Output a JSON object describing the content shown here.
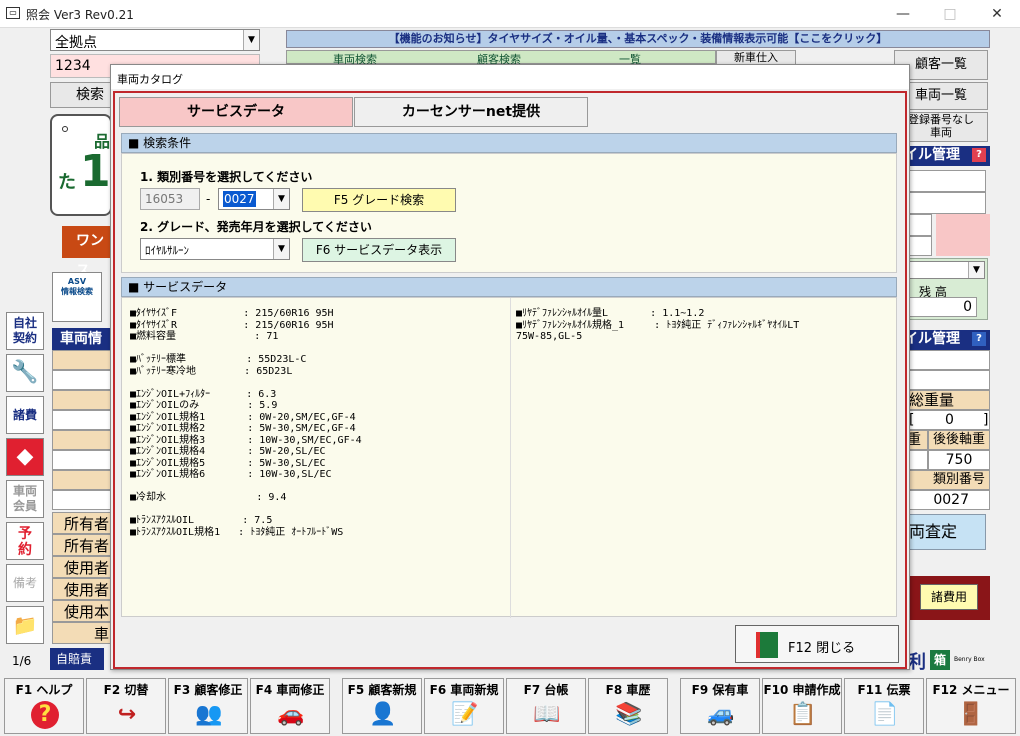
{
  "window": {
    "title": "照会 Ver3 Rev0.21",
    "min": "—",
    "max": "□",
    "close": "✕"
  },
  "bg": {
    "store_select": "全拠点",
    "code_field": "1234",
    "search_btn": "検索",
    "notice_bar": "【機能のお知らせ】タイヤサイズ・オイル量、・基本スペック・装備情報表示可能【ここをクリック】",
    "tabs_top": [
      "車両検索",
      "顧客検索",
      "一覧"
    ],
    "new_btn": "新車仕入",
    "right_buttons": [
      "顧客一覧",
      "車両一覧",
      "登録番号なし\n車両"
    ],
    "oil_mgmt": "イル管理",
    "plate_hira": "た",
    "plate_num": "1",
    "plate_region": "品",
    "onestop": "ワンス",
    "asv_label": "ASV\n情報検索",
    "vehicle_info": "車両情",
    "zan_ko": "残 高",
    "zan_val": "0",
    "oil_mgmt2": "イル管理",
    "total_weight": "総重量",
    "tw_open": "[",
    "tw_val": "0",
    "tw_close": "]",
    "weight": "重",
    "rear_axle": "後後軸重",
    "rear_val": "750",
    "type_no_label": "類別番号",
    "type_no_val": "0027",
    "satei": "両査定",
    "shohiyo": "諸費用",
    "owner_rows": [
      "所有者",
      "所有者",
      "使用者",
      "使用者",
      "使用本",
      "車"
    ],
    "page": "1/6",
    "jibaiseki": "自賠責",
    "logo_text": "利",
    "logo_box": "箱",
    "logo_sub": "Benry Box",
    "left_icons": [
      "自社\n契約",
      "🔧",
      "諸費",
      "◆",
      "車両\n会員",
      "予\n約",
      "備考",
      "📁"
    ]
  },
  "modal": {
    "title": "車両カタログ",
    "tab_service": "サービスデータ",
    "tab_carsensor": "カーセンサーnet提供",
    "search_header": "■ 検索条件",
    "step1": "1. 類別番号を選択してください",
    "type1": "16053",
    "dash": "-",
    "type2": "0027",
    "f5": "F5 グレード検索",
    "step2": "2. グレード、発売年月を選択してください",
    "grade": "ﾛｲﾔﾙｻﾙｰﾝ",
    "f6": "F6 サービスデータ表示",
    "service_header": "■ サービスデータ",
    "left_col": "■ﾀｲﾔｻｲｽﾞF           : 215/60R16 95H\n■ﾀｲﾔｻｲｽﾞR           : 215/60R16 95H\n■燃料容量             : 71\n\n■ﾊﾞｯﾃﾘｰ標準          : 55D23L-C\n■ﾊﾞｯﾃﾘｰ寒冷地        : 65D23L\n\n■ｴﾝｼﾞﾝOIL+ﾌｨﾙﾀｰ      : 6.3\n■ｴﾝｼﾞﾝOILのみ        : 5.9\n■ｴﾝｼﾞﾝOIL規格1       : 0W-20,SM/EC,GF-4\n■ｴﾝｼﾞﾝOIL規格2       : 5W-30,SM/EC,GF-4\n■ｴﾝｼﾞﾝOIL規格3       : 10W-30,SM/EC,GF-4\n■ｴﾝｼﾞﾝOIL規格4       : 5W-20,SL/EC\n■ｴﾝｼﾞﾝOIL規格5       : 5W-30,SL/EC\n■ｴﾝｼﾞﾝOIL規格6       : 10W-30,SL/EC\n\n■冷却水               : 9.4\n\n■ﾄﾗﾝｽｱｸｽﾙOIL        : 7.5\n■ﾄﾗﾝｽｱｸｽﾙOIL規格1   : ﾄﾖﾀ純正 ｵｰﾄﾌﾙｰﾄﾞWS",
    "right_col": "■ﾘﾔﾃﾞﾌｧﾚﾝｼｬﾙｵｲﾙ量L       : 1.1~1.2\n■ﾘﾔﾃﾞﾌｧﾚﾝｼｬﾙｵｲﾙ規格_1     : ﾄﾖﾀ純正 ﾃﾞｨﾌｧﾚﾝｼｬﾙｷﾞﾔｵｲﾙLT\n75W-85,GL-5",
    "f12_close": "F12 閉じる"
  },
  "fkeys": [
    {
      "label": "F1 ヘルプ",
      "icon": "?"
    },
    {
      "label": "F2 切替",
      "icon": "↪"
    },
    {
      "label": "F3 顧客修正",
      "icon": "👥"
    },
    {
      "label": "F4 車両修正",
      "icon": "🚗"
    },
    {
      "label": "F5 顧客新規",
      "icon": "👤"
    },
    {
      "label": "F6 車両新規",
      "icon": "📝"
    },
    {
      "label": "F7 台帳",
      "icon": "📖"
    },
    {
      "label": "F8 車歴",
      "icon": "📚"
    },
    {
      "label": "F9 保有車",
      "icon": "🚙"
    },
    {
      "label": "F10 申請作成",
      "icon": "📋"
    },
    {
      "label": "F11 伝票",
      "icon": "📄"
    },
    {
      "label": "F12 メニュー",
      "icon": "🚪"
    }
  ]
}
